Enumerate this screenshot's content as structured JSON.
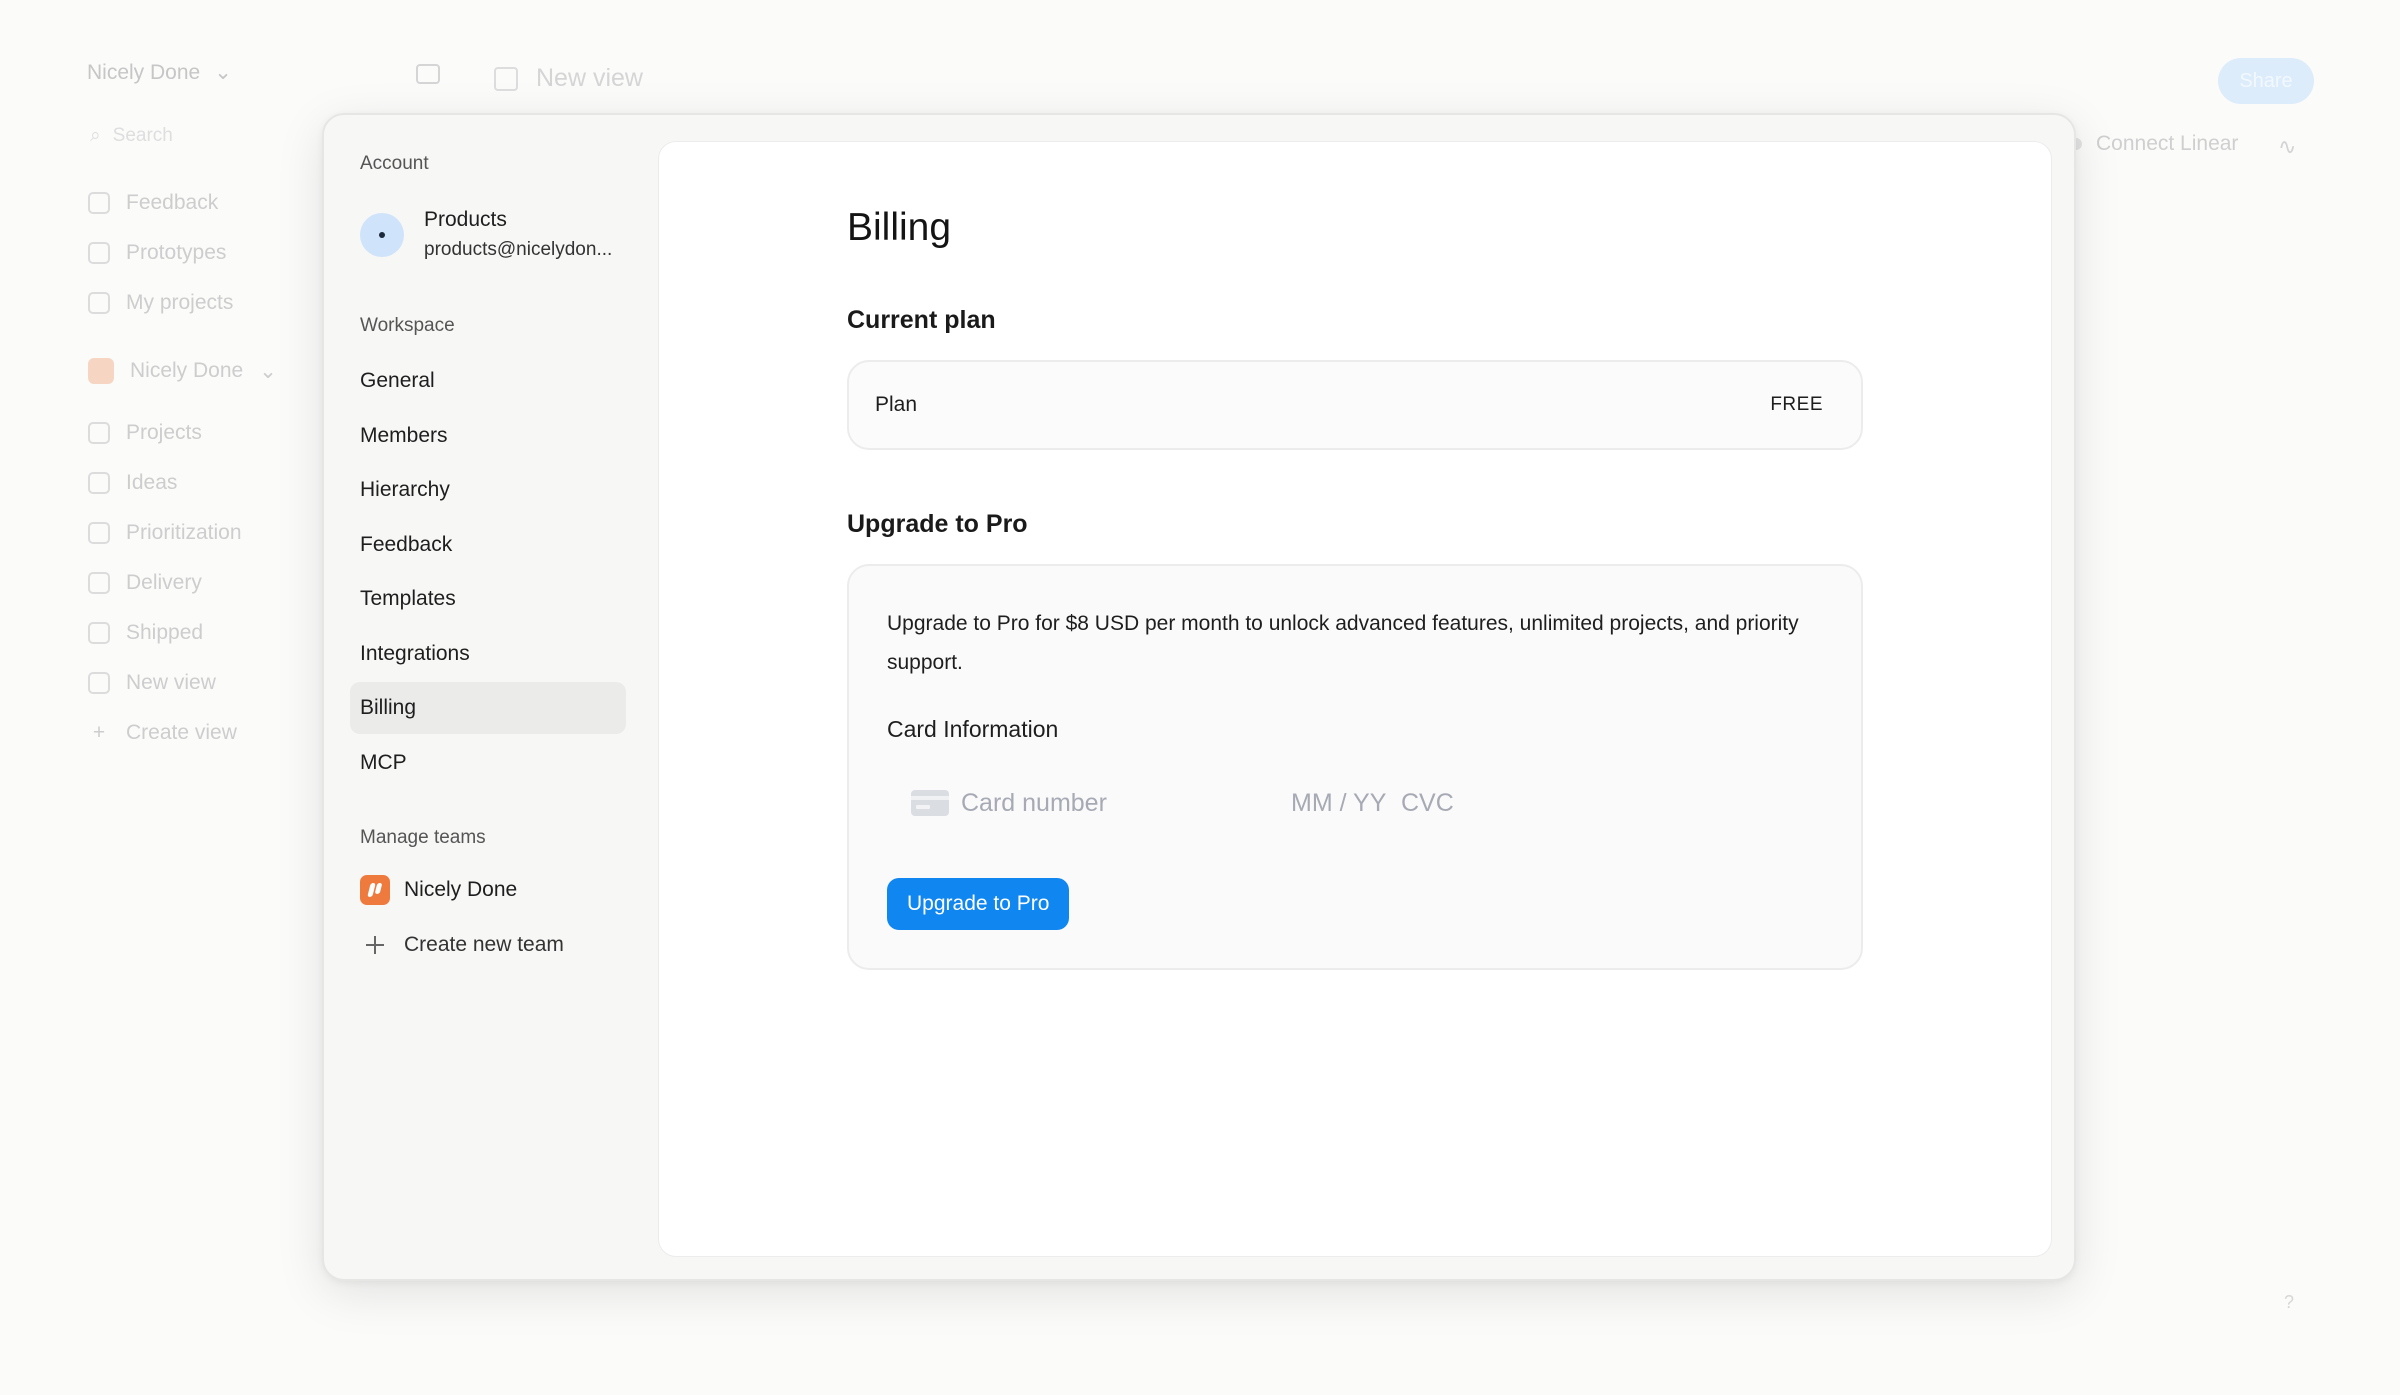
{
  "background": {
    "workspace_name": "Nicely Done",
    "search_placeholder": "Search",
    "nav_top": [
      "Feedback",
      "Prototypes",
      "My projects"
    ],
    "team_name": "Nicely Done",
    "nav_team": [
      "Projects",
      "Ideas",
      "Prioritization",
      "Delivery",
      "Shipped",
      "New view",
      "Create view"
    ],
    "view_title": "New view",
    "share_label": "Share",
    "connect_label": "Connect Linear",
    "help_label": "?"
  },
  "settings": {
    "account_section": "Account",
    "account": {
      "name": "Products",
      "email": "products@nicelydon..."
    },
    "workspace_section": "Workspace",
    "workspace_items": [
      "General",
      "Members",
      "Hierarchy",
      "Feedback",
      "Templates",
      "Integrations",
      "Billing",
      "MCP"
    ],
    "active_item": "Billing",
    "teams_section": "Manage teams",
    "team_name": "Nicely Done",
    "create_team_label": "Create new team"
  },
  "billing": {
    "title": "Billing",
    "current_plan_title": "Current plan",
    "plan_label": "Plan",
    "plan_value": "FREE",
    "upgrade_title": "Upgrade to Pro",
    "upgrade_description": "Upgrade to Pro for $8 USD per month to unlock advanced features, unlimited projects, and priority support.",
    "card_info_label": "Card Information",
    "card_number_placeholder": "Card number",
    "card_exp_placeholder": "MM / YY",
    "card_cvc_placeholder": "CVC",
    "upgrade_button_label": "Upgrade to Pro"
  },
  "colors": {
    "accent": "#1086f0",
    "team_logo": "#ef7a3e",
    "avatar": "#cfe3fb"
  }
}
